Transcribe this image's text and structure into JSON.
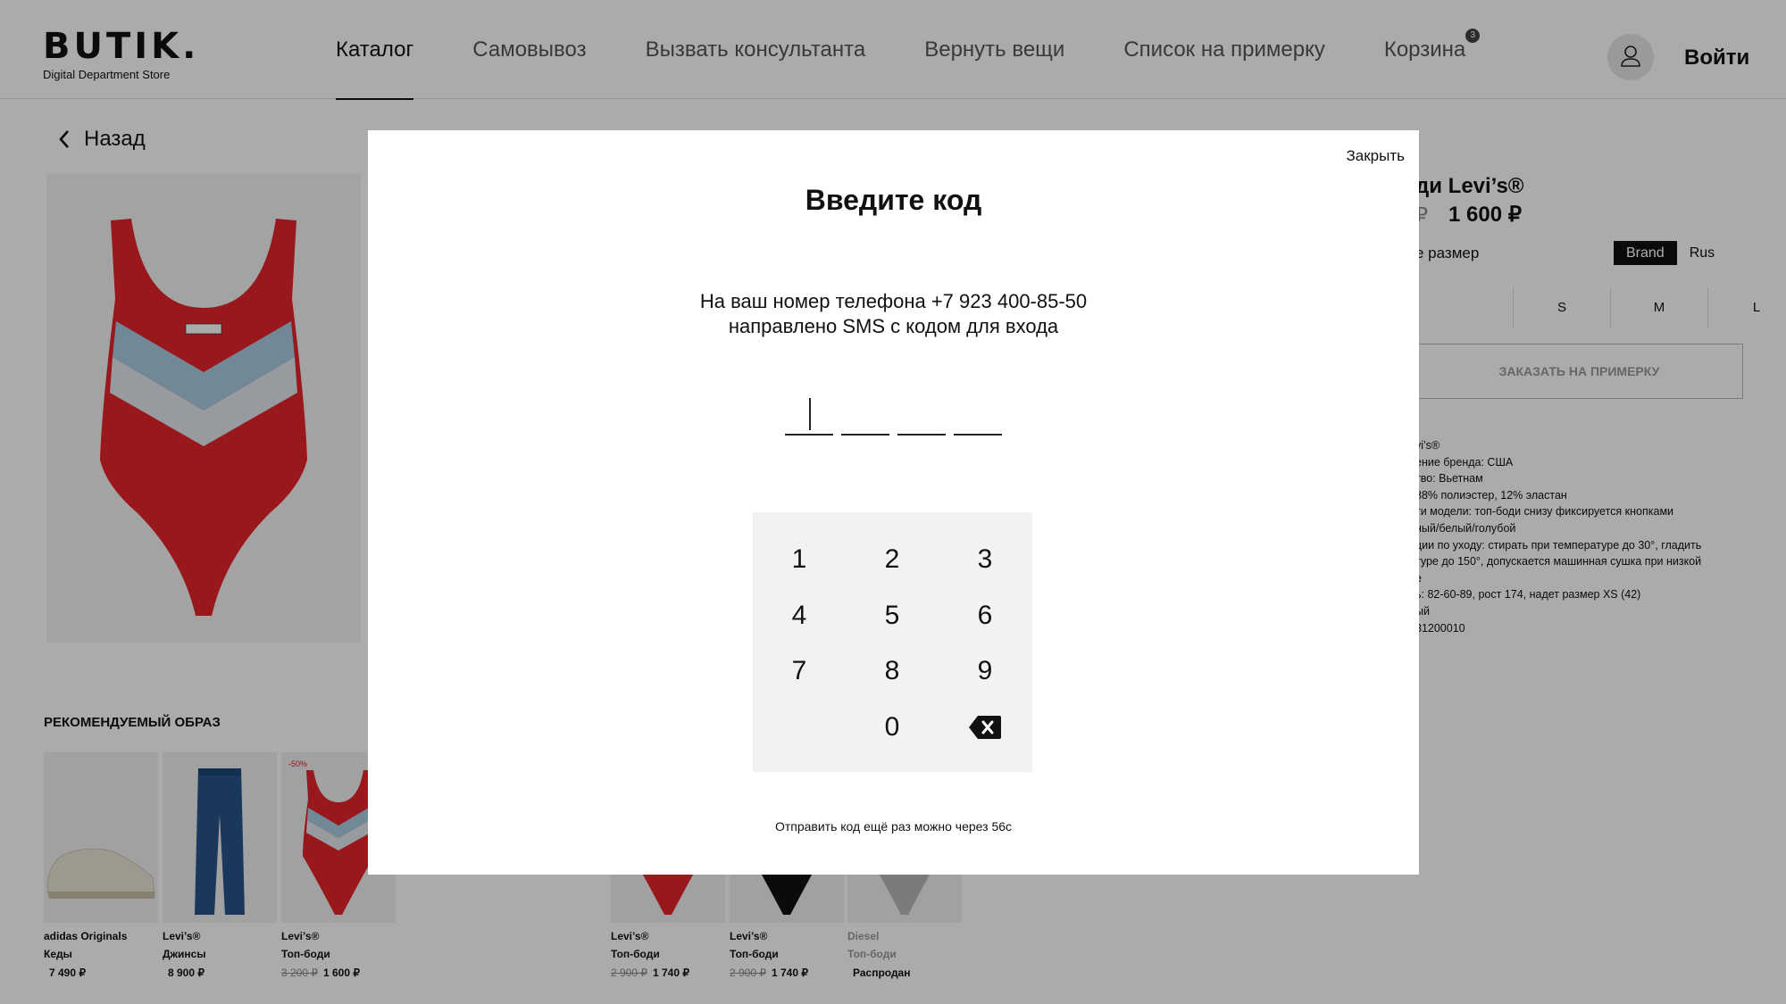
{
  "header": {
    "logo": "BUTIK.",
    "logo_sub": "Digital Department Store",
    "nav": [
      "Каталог",
      "Самовывоз",
      "Вызвать консультанта",
      "Вернуть вещи",
      "Список на примерку",
      "Корзина"
    ],
    "cart_count": "3",
    "login": "Войти"
  },
  "product": {
    "back": "Назад",
    "name": "ди Levi’s®",
    "old_price": "₽",
    "price": "1 600 ₽",
    "size_label": "е размер",
    "size_toggle": [
      "Brand",
      "Rus"
    ],
    "sizes": [
      "",
      "S",
      "M",
      "L"
    ],
    "order_button": "ЗАКАЗАТЬ НА ПРИМЕРКУ",
    "description": [
      "vi’s®",
      "ение бренда: США",
      "тво: Вьетнам",
      "88% полиэстер, 12% эластан",
      "ти модели: топ-боди снизу фиксируется кнопками",
      "ный/белый/голубой",
      "ции по уходу: стирать при температуре до 30°, гладить",
      "туре до 150°, допускается машинная сушка при низкой",
      "е",
      "ь: 82-60-89, рост 174, надет размер XS (42)",
      "ый",
      "31200010"
    ]
  },
  "recommended": {
    "title": "РЕКОМЕНДУЕМЫЙ ОБРАЗ",
    "items": [
      {
        "brand": "adidas Originals",
        "name": "Кеды",
        "old_price": "",
        "price": "7 490 ₽"
      },
      {
        "brand": "Levi’s®",
        "name": "Джинсы",
        "old_price": "",
        "price": "8 900 ₽"
      },
      {
        "brand": "Levi’s®",
        "name": "Топ-боди",
        "old_price": "3 200 ₽",
        "price": "1 600 ₽",
        "discount": "-50%"
      },
      {
        "brand": "Levi’s®",
        "name": "Топ-боди",
        "old_price": "2 900 ₽",
        "price": "1 740 ₽"
      },
      {
        "brand": "Levi’s®",
        "name": "Топ-боди",
        "old_price": "2 900 ₽",
        "price": "1 740 ₽"
      },
      {
        "brand": "Diesel",
        "name": "Топ-боди",
        "old_price": "",
        "price": "Распродан"
      }
    ]
  },
  "modal": {
    "close": "Закрыть",
    "title": "Введите код",
    "text_line1": "На ваш номер телефона +7 923 400-85-50",
    "text_line2": "направлено SMS с кодом для входа",
    "keys": [
      "1",
      "2",
      "3",
      "4",
      "5",
      "6",
      "7",
      "8",
      "9",
      "0"
    ],
    "resend": "Отправить код ещё раз можно через 56с"
  },
  "icons": {
    "back": "chevron-left-icon",
    "user": "user-icon",
    "backspace": "backspace-icon"
  },
  "colors": {
    "swimsuit_red": "#e3242b",
    "stripe_blue": "#a9cde2",
    "denim": "#27538a"
  }
}
